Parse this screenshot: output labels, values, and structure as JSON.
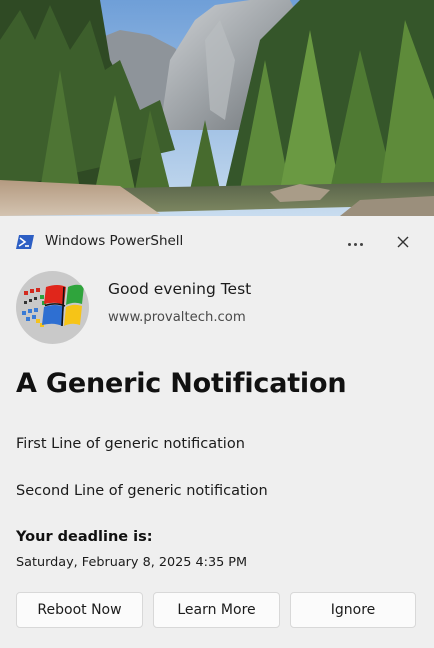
{
  "header": {
    "app_name": "Windows PowerShell",
    "app_icon": "powershell-icon",
    "more_icon": "more-options-icon",
    "close_icon": "close-icon"
  },
  "hero": {
    "description_icon": "hero-landscape-image"
  },
  "attribution": {
    "logo_icon": "windows-logo-icon",
    "greeting": "Good evening Test",
    "site": "www.provaltech.com"
  },
  "notification": {
    "title": "A Generic Notification",
    "line1": "First Line of generic notification",
    "line2": "Second Line of generic notification",
    "deadline_label": "Your deadline is:",
    "deadline_value": "Saturday, February 8, 2025 4:35 PM"
  },
  "actions": {
    "reboot_now": "Reboot Now",
    "learn_more": "Learn More",
    "ignore": "Ignore"
  },
  "colors": {
    "background": "#efefef",
    "button_bg": "#fbfbfb",
    "powershell_blue": "#2d5fc4"
  }
}
